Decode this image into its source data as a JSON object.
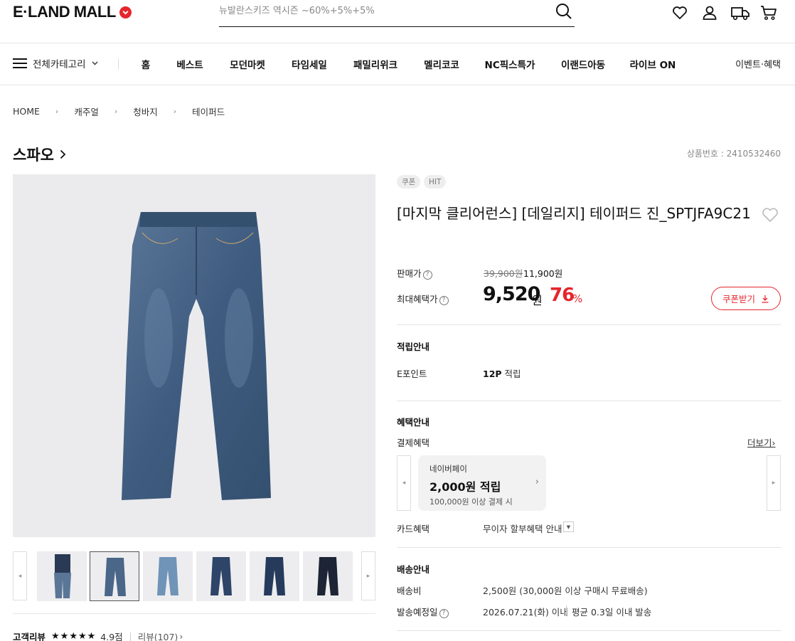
{
  "header": {
    "logo": "E·LAND MALL",
    "search_placeholder": "뉴발란스키즈 역시즌 ~60%+5%+5%"
  },
  "gnb": {
    "all_categories": "전체카테고리",
    "items": [
      "홈",
      "베스트",
      "모던마켓",
      "타임세일",
      "패밀리위크",
      "멜리코코",
      "NC픽스특가",
      "이랜드아동",
      "라이브 ON"
    ],
    "event": "이벤트·혜택"
  },
  "breadcrumb": [
    "HOME",
    "캐주얼",
    "청바지",
    "테이퍼드"
  ],
  "brand": "스파오",
  "product_number": "상품번호 : 2410532460",
  "badges": [
    "쿠폰",
    "HIT"
  ],
  "title": "[마지막 클리어런스] [데일리지] 테이퍼드 진_SPTJFA9C21",
  "price": {
    "label": "판매가",
    "original": "39,900원",
    "sale": "11,900원",
    "max_label": "최대혜택가",
    "max": "9,520",
    "max_unit": "원",
    "discount": "76",
    "discount_unit": "%",
    "coupon_button": "쿠폰받기"
  },
  "points": {
    "section": "적립안내",
    "label": "E포인트",
    "amount": "12P",
    "suffix": "적립"
  },
  "benefits": {
    "section": "혜택안내",
    "payment_label": "결제혜택",
    "more": "더보기",
    "pay_name": "네이버페이",
    "pay_amount": "2,000원 적립",
    "pay_condition": "100,000원 이상 결제 시",
    "card_label": "카드혜택",
    "card_value": "무이자 할부혜택 안내"
  },
  "shipping": {
    "section": "배송안내",
    "fee_label": "배송비",
    "fee_value": "2,500원 (30,000원 이상 구매시 무료배송)",
    "date_label": "발송예정일",
    "date_value": "2026.07.21(화) 이내",
    "avg_value": "평균 0.3일 이내 발송"
  },
  "review": {
    "label": "고객리뷰",
    "stars": "★★★★★",
    "rating": "4.9점",
    "count": "리뷰(107)"
  },
  "colors": {
    "accent": "#e5262d",
    "denim": "#4a6688"
  }
}
